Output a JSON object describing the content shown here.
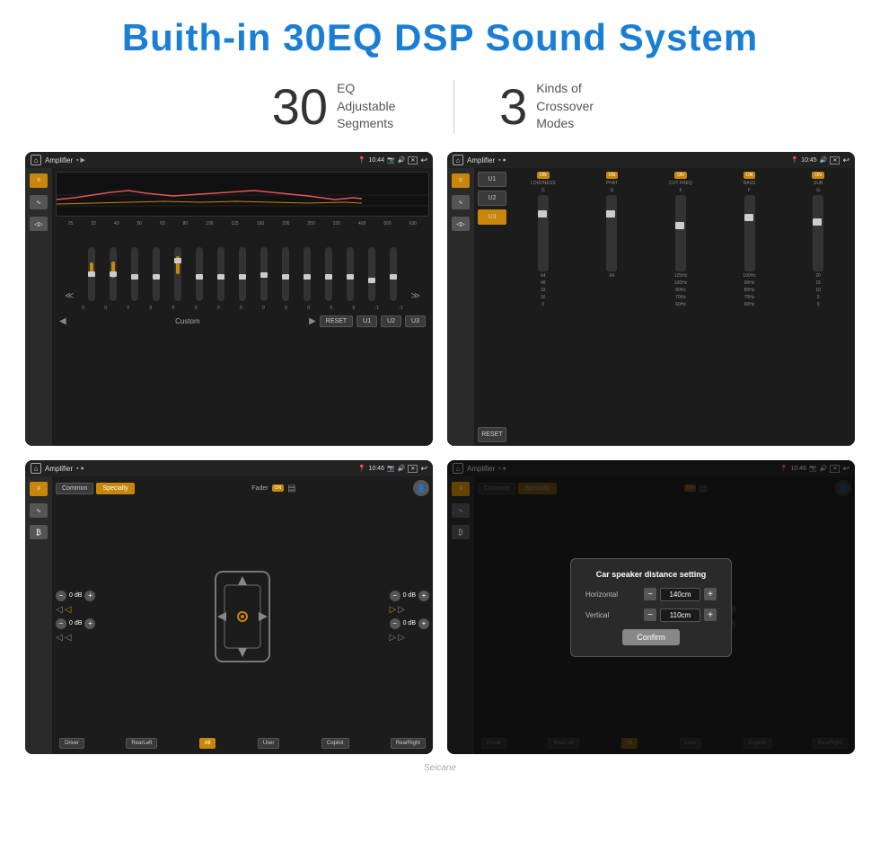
{
  "header": {
    "title": "Buith-in 30EQ DSP Sound System"
  },
  "stats": {
    "eq_number": "30",
    "eq_desc_line1": "EQ Adjustable",
    "eq_desc_line2": "Segments",
    "cross_number": "3",
    "cross_desc_line1": "Kinds of",
    "cross_desc_line2": "Crossover Modes"
  },
  "screen1": {
    "title": "Amplifier",
    "time": "10:44",
    "freq_labels": [
      "25",
      "32",
      "40",
      "50",
      "63",
      "80",
      "100",
      "125",
      "160",
      "200",
      "250",
      "320",
      "400",
      "500",
      "630"
    ],
    "slider_values": [
      "0",
      "0",
      "0",
      "0",
      "5",
      "0",
      "0",
      "0",
      "0",
      "0",
      "0",
      "0",
      "0",
      "-1",
      "0",
      "-1"
    ],
    "buttons": [
      "RESET",
      "U1",
      "U2",
      "U3"
    ],
    "preset_label": "Custom"
  },
  "screen2": {
    "title": "Amplifier",
    "time": "10:45",
    "presets": [
      "U1",
      "U2",
      "U3"
    ],
    "active_preset": "U3",
    "channels": [
      "LOUDNESS",
      "PHAT",
      "CUT FREQ",
      "BASS",
      "SUB"
    ],
    "toggles": [
      "ON",
      "ON",
      "ON",
      "ON",
      "ON"
    ],
    "reset_btn": "RESET"
  },
  "screen3": {
    "title": "Amplifier",
    "time": "10:46",
    "mode_tabs": [
      "Common",
      "Specialty"
    ],
    "active_tab": "Specialty",
    "fader_label": "Fader",
    "fader_state": "ON",
    "db_labels": [
      "0 dB",
      "0 dB",
      "0 dB",
      "0 dB"
    ],
    "position_btns": [
      "Driver",
      "RearLeft",
      "All",
      "User",
      "Copilot",
      "RearRight"
    ]
  },
  "screen4": {
    "title": "Amplifier",
    "time": "10:46",
    "mode_tabs": [
      "Common",
      "Specialty"
    ],
    "active_tab": "Specialty",
    "dialog": {
      "title": "Car speaker distance setting",
      "horizontal_label": "Horizontal",
      "horizontal_value": "140cm",
      "vertical_label": "Vertical",
      "vertical_value": "110cm",
      "confirm_btn": "Confirm"
    },
    "position_btns": [
      "Driver",
      "RearLeft",
      "All",
      "User",
      "Copilot",
      "RearRight"
    ]
  },
  "watermark": "Seicane"
}
